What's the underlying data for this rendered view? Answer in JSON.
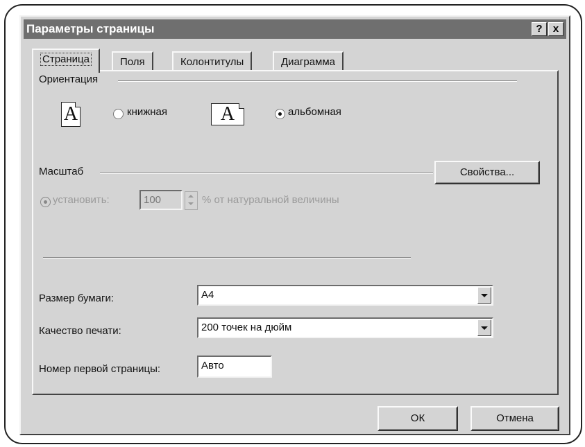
{
  "window": {
    "title": "Параметры страницы",
    "help_label": "?",
    "close_label": "x"
  },
  "tabs": [
    {
      "label": "Страница",
      "active": true
    },
    {
      "label": "Поля",
      "active": false
    },
    {
      "label": "Колонтитулы",
      "active": false
    },
    {
      "label": "Диаграмма",
      "active": false
    }
  ],
  "orientation": {
    "group_label": "Ориентация",
    "portrait_label": "книжная",
    "landscape_label": "альбомная",
    "selected": "landscape",
    "icon_letter": "A"
  },
  "scale": {
    "group_label": "Масштаб",
    "set_label": "установить:",
    "value": "100",
    "suffix": "% от натуральной величины"
  },
  "buttons": {
    "properties": "Свойства...",
    "ok": "ОК",
    "cancel": "Отмена"
  },
  "paper_size": {
    "label": "Размер бумаги:",
    "value": "A4"
  },
  "print_quality": {
    "label": "Качество печати:",
    "value": "200 точек на дюйм"
  },
  "first_page": {
    "label": "Номер первой страницы:",
    "value": "Авто"
  }
}
